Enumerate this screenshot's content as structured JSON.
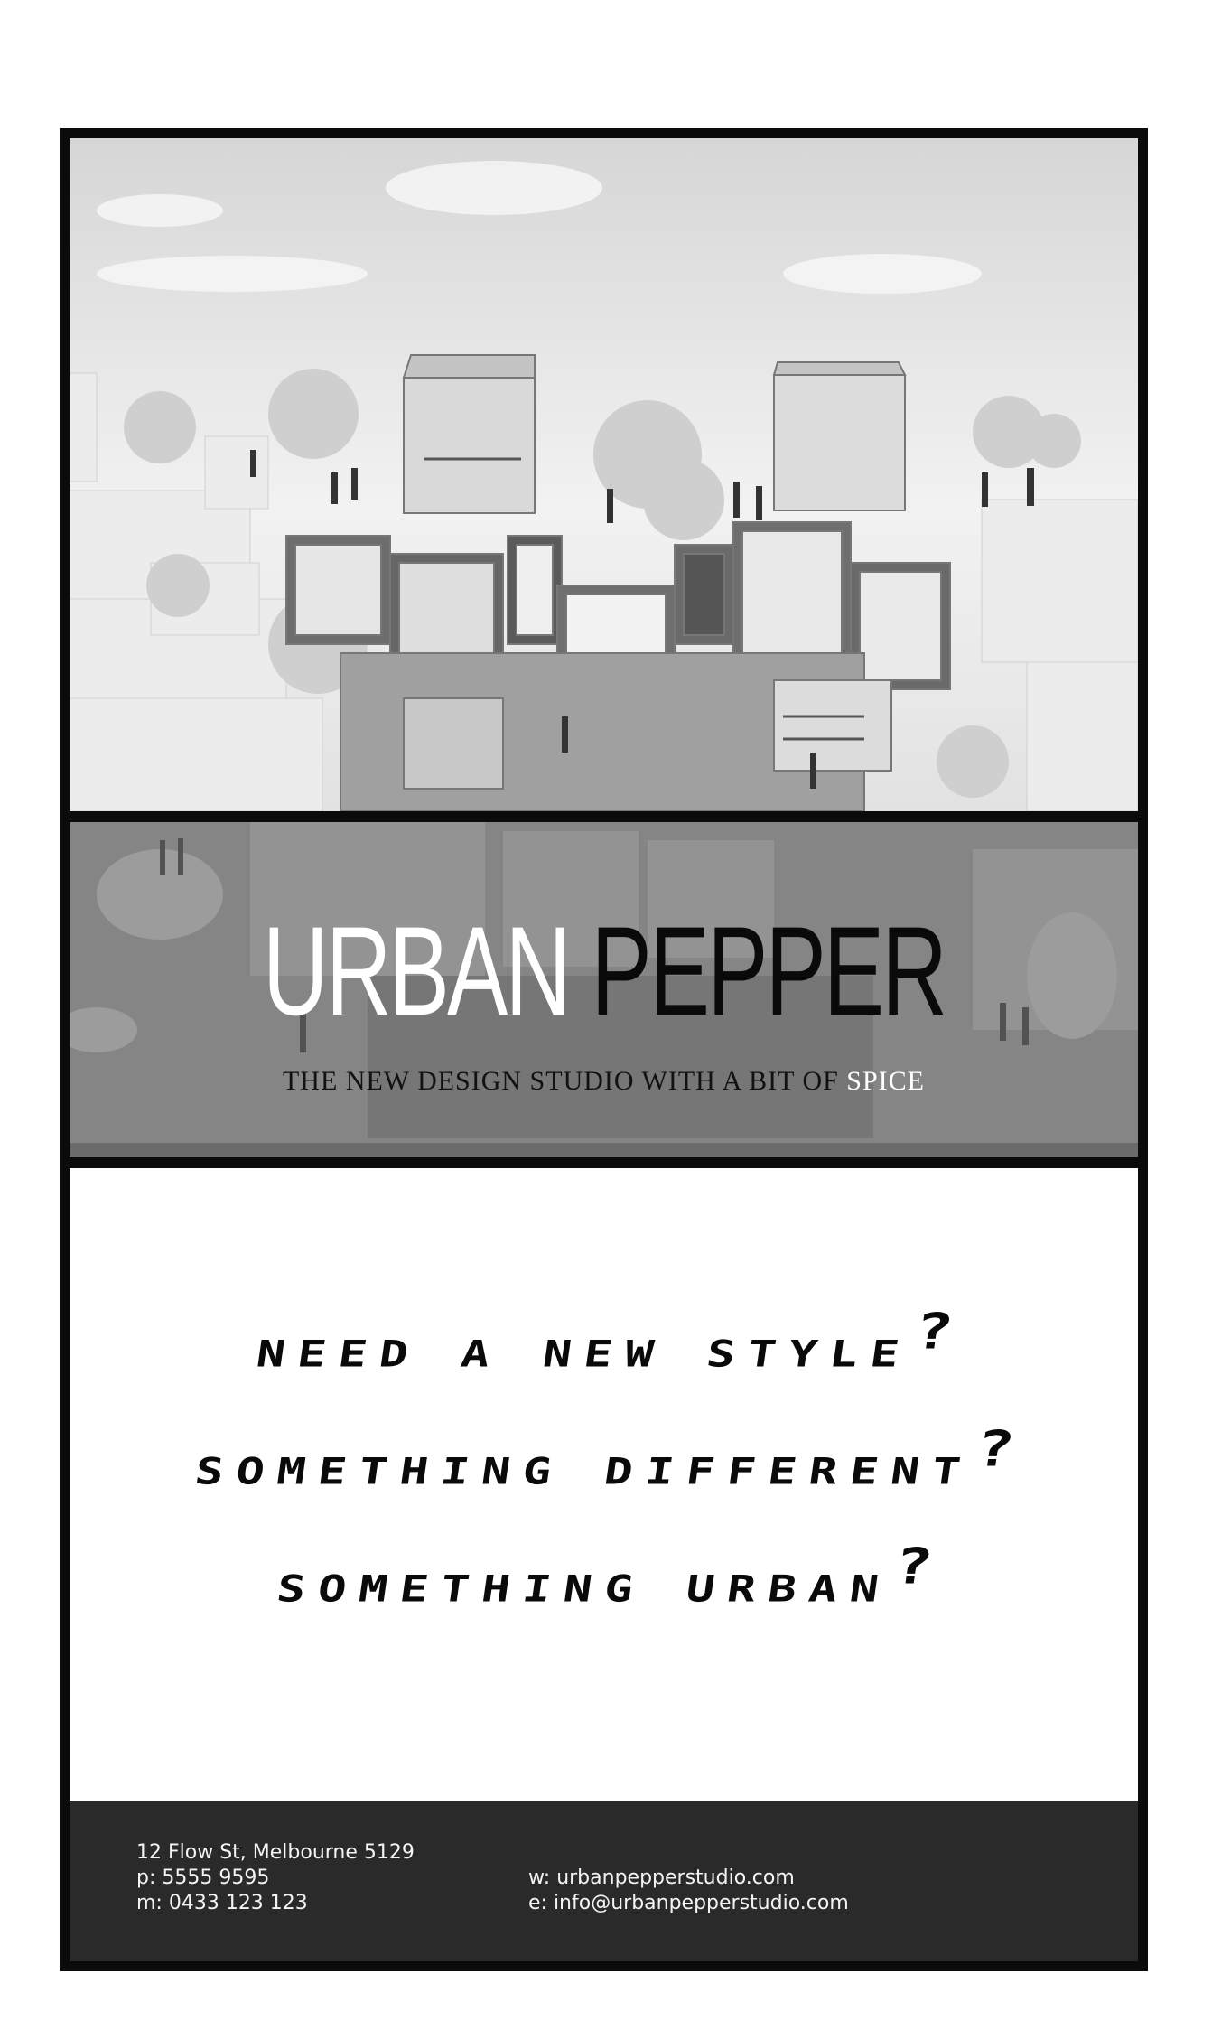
{
  "brand": {
    "word1": "URBAN",
    "word2": "PEPPER",
    "tagline": "THE NEW DESIGN STUDIO WITH A BIT OF",
    "tagline_accent": "SPICE"
  },
  "copy": {
    "line1": "NEED A NEW STYLE",
    "line2": "SOMETHING DIFFERENT",
    "line3": "SOMETHING URBAN",
    "mark": "?"
  },
  "contact": {
    "address": "12 Flow St, Melbourne 5129",
    "phone": "p: 5555 9595",
    "mobile": "m: 0433 123 123",
    "website": "w: urbanpepperstudio.com",
    "email": "e: info@urbanpepperstudio.com"
  },
  "colors": {
    "frame": "#0b0b0b",
    "band": "#8d8d8d",
    "footer": "#2a2a2a"
  }
}
